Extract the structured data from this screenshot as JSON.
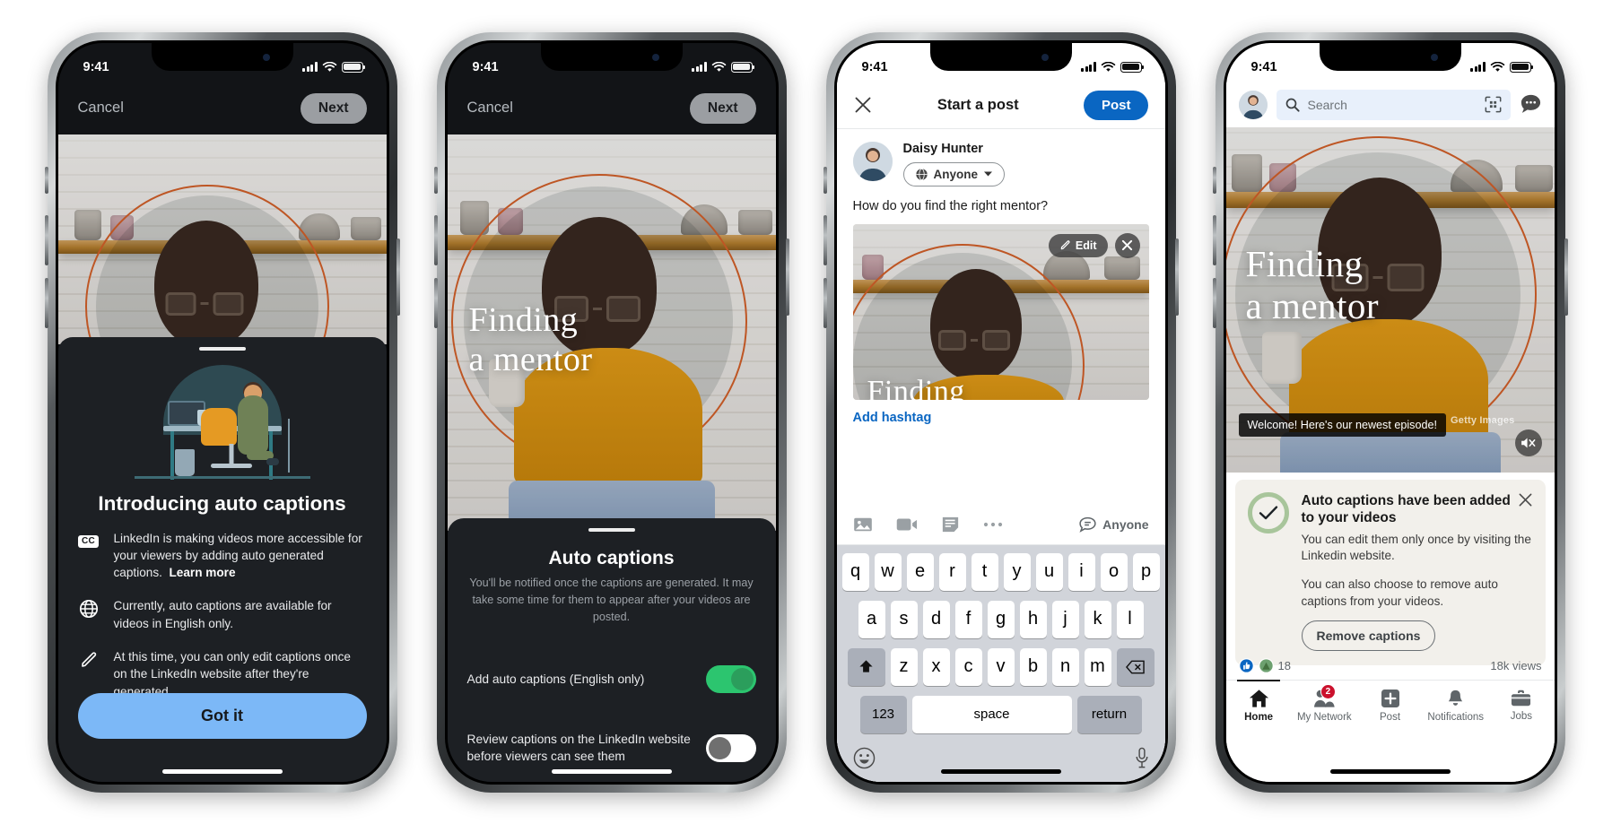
{
  "status_bar": {
    "time": "9:41",
    "signal_icon": "cellular-bars-icon",
    "wifi_icon": "wifi-icon",
    "battery_icon": "battery-icon"
  },
  "colors": {
    "linkedin_blue": "#0a66c2",
    "accent_button": "#7cb8f7",
    "toggle_on": "#2cc56f",
    "toggle_off_knob": "#6f6f6f",
    "sheet_bg": "#1d2024",
    "toast_bg": "#f2f0eb",
    "badge_red": "#cb112d",
    "photo_ring": "#d9622a"
  },
  "phone1": {
    "nav": {
      "cancel_label": "Cancel",
      "next_label": "Next"
    },
    "illustration_name": "woman-at-desk-illustration",
    "title": "Introducing auto captions",
    "bullets": [
      {
        "icon": "closed-caption-icon",
        "icon_label": "CC",
        "text": "LinkedIn is making videos more accessible for your viewers by adding auto generated captions.",
        "link": "Learn more"
      },
      {
        "icon": "globe-icon",
        "text": "Currently, auto captions are available for videos in English only."
      },
      {
        "icon": "pencil-icon",
        "text": "At this time, you can only edit captions once on the LinkedIn website after they're generated."
      }
    ],
    "primary_button": "Got it"
  },
  "phone2": {
    "nav": {
      "cancel_label": "Cancel",
      "next_label": "Next"
    },
    "video_overlay_line1": "Finding",
    "video_overlay_line2": "a mentor",
    "sheet_title": "Auto captions",
    "sheet_subtitle": "You'll be notified once the captions are generated. It may take some time for them to appear after your videos are posted.",
    "rows": [
      {
        "label": "Add auto captions (English only)",
        "toggle": "on"
      },
      {
        "label": "Review captions on the LinkedIn website before viewers can see them",
        "toggle": "off"
      }
    ]
  },
  "phone3": {
    "close_icon": "close-x-icon",
    "title": "Start a post",
    "post_button": "Post",
    "author_name": "Daisy Hunter",
    "author_avatar": "user-avatar",
    "audience_pill": {
      "icon": "globe-icon",
      "label": "Anyone",
      "chevron": "chevron-down-icon"
    },
    "post_text": "How do you find the right mentor?",
    "attachment": {
      "edit_label": "Edit",
      "edit_icon": "pencil-icon",
      "remove_icon": "close-x-icon",
      "overlay_text": "Finding"
    },
    "hashtag_link": "Add hashtag",
    "toolbar": {
      "icons": [
        "photo-icon",
        "video-camera-icon",
        "document-icon",
        "more-ellipsis-icon"
      ],
      "audience_icon": "comment-bubble-icon",
      "audience_label": "Anyone"
    },
    "keyboard": {
      "row1": [
        "q",
        "w",
        "e",
        "r",
        "t",
        "y",
        "u",
        "i",
        "o",
        "p"
      ],
      "row2": [
        "a",
        "s",
        "d",
        "f",
        "g",
        "h",
        "j",
        "k",
        "l"
      ],
      "row3": [
        "z",
        "x",
        "c",
        "v",
        "b",
        "n",
        "m"
      ],
      "shift_icon": "shift-arrow-icon",
      "backspace_icon": "backspace-icon",
      "numbers_key": "123",
      "space_key": "space",
      "return_key": "return",
      "emoji_icon": "emoji-smiley-icon",
      "mic_icon": "microphone-icon"
    }
  },
  "phone4": {
    "search": {
      "avatar": "user-avatar",
      "search_icon": "search-icon",
      "placeholder": "Search",
      "qr_icon": "qr-scan-icon",
      "messaging_icon": "messaging-bubble-icon"
    },
    "video": {
      "overlay_line1": "Finding",
      "overlay_line2": "a mentor",
      "caption_text": "Welcome! Here's our newest episode!",
      "watermark": "Getty Images",
      "mute_icon": "speaker-muted-icon"
    },
    "toast": {
      "status_icon": "check-circle-icon",
      "close_icon": "close-x-icon",
      "title": "Auto captions have been added to your videos",
      "body1": "You can edit them only once by visiting the Linkedin website.",
      "body2": "You can also choose to remove auto captions from your videos.",
      "action_button": "Remove captions"
    },
    "social": {
      "reaction_count": "18",
      "views": "18k views"
    },
    "tabs": [
      {
        "label": "Home",
        "icon": "home-icon",
        "active": true,
        "badge": ""
      },
      {
        "label": "My Network",
        "icon": "people-icon",
        "active": false,
        "badge": "2"
      },
      {
        "label": "Post",
        "icon": "plus-square-icon",
        "active": false,
        "badge": ""
      },
      {
        "label": "Notifications",
        "icon": "bell-icon",
        "active": false,
        "badge": ""
      },
      {
        "label": "Jobs",
        "icon": "briefcase-icon",
        "active": false,
        "badge": ""
      }
    ]
  }
}
